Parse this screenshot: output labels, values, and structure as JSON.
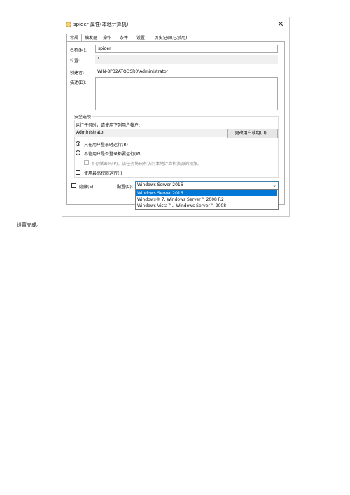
{
  "dialog": {
    "title": "spider 属性(本地计算机)",
    "close_glyph": "✕",
    "tabs": [
      {
        "label": "常规",
        "active": true
      },
      {
        "label": "触发器",
        "active": false
      },
      {
        "label": "操作",
        "active": false
      },
      {
        "label": "条件",
        "active": false
      },
      {
        "label": "设置",
        "active": false
      },
      {
        "label": "历史记录(已禁用)",
        "active": false
      }
    ],
    "general": {
      "name_label": "名称(M):",
      "name_value": "spider",
      "location_label": "位置:",
      "location_value": "\\",
      "author_label": "创建者:",
      "author_value": "WIN-8PB2ATQDSR0\\Administrator",
      "description_label": "描述(D):",
      "description_value": ""
    },
    "security": {
      "group_label": "安全选项",
      "run_as_prompt": "运行任务时，请使用下列用户帐户:",
      "user_account": "Administrator",
      "change_user_button": "更改用户或组(U)...",
      "radio_logged_on": "只在用户登录时运行(R)",
      "radio_logged_on_selected": true,
      "radio_whether_logged": "不管用户是否登录都要运行(W)",
      "radio_whether_logged_selected": false,
      "no_store_password": "不存储密码(P)。该任务将只有访问本地计算机资源的权限。",
      "highest_privileges": "使用最高权限运行(I)"
    },
    "bottom": {
      "hidden_label": "隐藏(E)",
      "configure_label": "配置(C):",
      "configure_value": "Windows Server 2016",
      "dropdown_options": [
        {
          "label": "Windows Server 2016",
          "selected": true
        },
        {
          "label": "Windows® 7, Windows Server™ 2008 R2",
          "selected": false
        },
        {
          "label": "Windows Vista™、Windows Server™ 2008",
          "selected": false
        }
      ]
    },
    "icons": {
      "title_icon": "clock-icon",
      "close_icon": "close-icon",
      "dropdown_arrow": "chevron-down-icon"
    },
    "colors": {
      "selection_blue": "#0078d7",
      "focus_border": "#3c7fb1"
    }
  },
  "caption": "设置完成。"
}
